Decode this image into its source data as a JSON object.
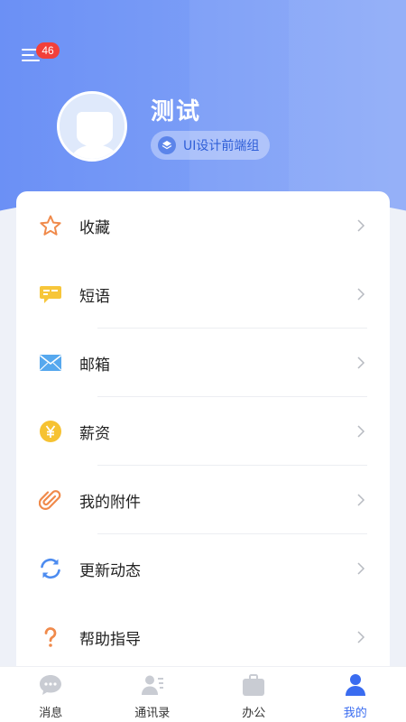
{
  "header": {
    "menu_badge": "46",
    "username": "测试",
    "group": "UI设计前端组"
  },
  "menu": {
    "items": [
      {
        "label": "收藏",
        "icon": "star-icon"
      },
      {
        "label": "短语",
        "icon": "chat-phrase-icon"
      },
      {
        "label": "邮箱",
        "icon": "mail-icon"
      },
      {
        "label": "薪资",
        "icon": "yen-coin-icon"
      },
      {
        "label": "我的附件",
        "icon": "paperclip-icon"
      },
      {
        "label": "更新动态",
        "icon": "refresh-icon"
      },
      {
        "label": "帮助指导",
        "icon": "question-icon"
      }
    ]
  },
  "tabbar": {
    "tabs": [
      {
        "label": "消息",
        "icon": "message-bubble-icon"
      },
      {
        "label": "通讯录",
        "icon": "contacts-icon"
      },
      {
        "label": "办公",
        "icon": "briefcase-icon"
      },
      {
        "label": "我的",
        "icon": "person-icon",
        "active": true
      }
    ]
  },
  "colors": {
    "header_start": "#6b90f5",
    "header_end": "#8aa8f8",
    "badge": "#f2403a",
    "accent": "#3a6cf0",
    "tab_inactive_icon": "#c9ccd3"
  }
}
